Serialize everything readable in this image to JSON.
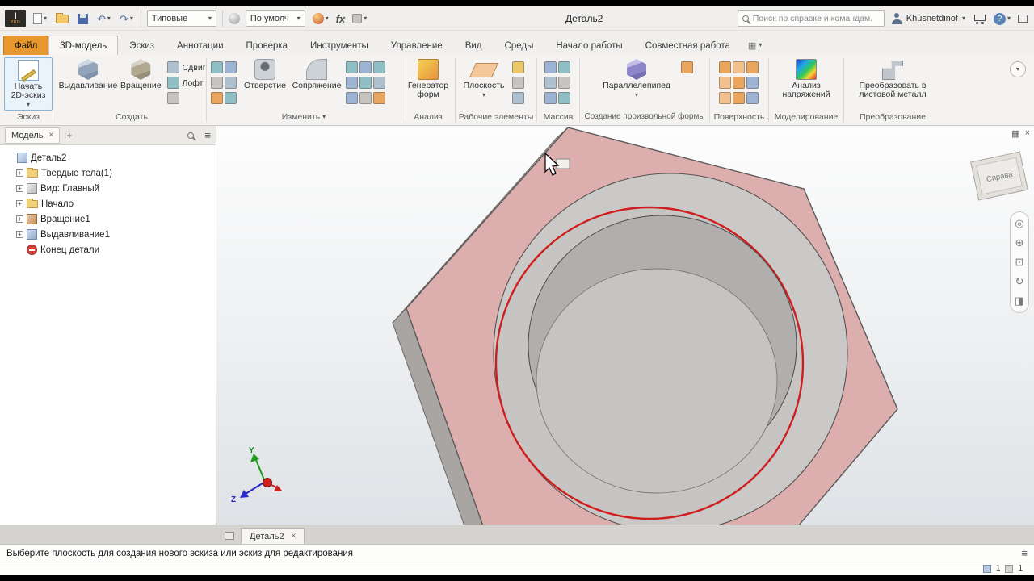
{
  "icons": {
    "dropdown": "▾",
    "close": "×",
    "plus": "+",
    "hamburger": "≡",
    "undo": "↶",
    "redo": "↷",
    "grid": "▦",
    "wheel": "◎",
    "pan": "⊕",
    "zoom": "⊡",
    "orbit": "↻",
    "look_at": "◨",
    "collapse": "▴"
  },
  "titlebar": {
    "logo": "I",
    "logo_sub": "PRO",
    "preset": "Типовые",
    "material": "По умолч",
    "fx_label": "fx",
    "doc_title": "Деталь2",
    "search_placeholder": "Поиск по справке и командам.",
    "user": "Khusnetdinof",
    "help": "?"
  },
  "tabs": [
    "Файл",
    "3D-модель",
    "Эскиз",
    "Аннотации",
    "Проверка",
    "Инструменты",
    "Управление",
    "Вид",
    "Среды",
    "Начало работы",
    "Совместная работа"
  ],
  "ribbon": {
    "sketch": {
      "label": "Эскиз",
      "start_sketch": "Начать 2D-эскиз"
    },
    "create": {
      "label": "Создать",
      "extrude": "Выдавливание",
      "revolve": "Вращение",
      "sweep": "Сдвиг",
      "loft": "Лофт"
    },
    "modify": {
      "label": "Изменить",
      "hole": "Отверстие",
      "fillet": "Сопряжение"
    },
    "explore": {
      "label": "Анализ",
      "shape_generator": "Генератор форм"
    },
    "work_features": {
      "label": "Рабочие элементы",
      "plane": "Плоскость"
    },
    "pattern": {
      "label": "Массив"
    },
    "freeform": {
      "label": "Создание произвольной формы",
      "box": "Параллелепипед"
    },
    "surface": {
      "label": "Поверхность"
    },
    "simulation": {
      "label": "Моделирование",
      "stress": "Анализ напряжений"
    },
    "convert": {
      "label": "Преобразование",
      "sheet_metal": "Преобразовать в листовой металл"
    }
  },
  "browser": {
    "panel_title": "Модель",
    "tree": [
      {
        "label": "Деталь2"
      },
      {
        "label": "Твердые тела(1)"
      },
      {
        "label": "Вид: Главный"
      },
      {
        "label": "Начало"
      },
      {
        "label": "Вращение1"
      },
      {
        "label": "Выдавливание1"
      },
      {
        "label": "Конец детали"
      }
    ]
  },
  "viewport": {
    "viewcube_face": "Справа",
    "axis_y": "Y",
    "axis_z": "Z",
    "doc_tab": "Деталь2"
  },
  "statusbar": {
    "message": "Выберите плоскость для создания нового эскиза или эскиз для редактирования",
    "counter1": "1",
    "counter2": "1"
  }
}
